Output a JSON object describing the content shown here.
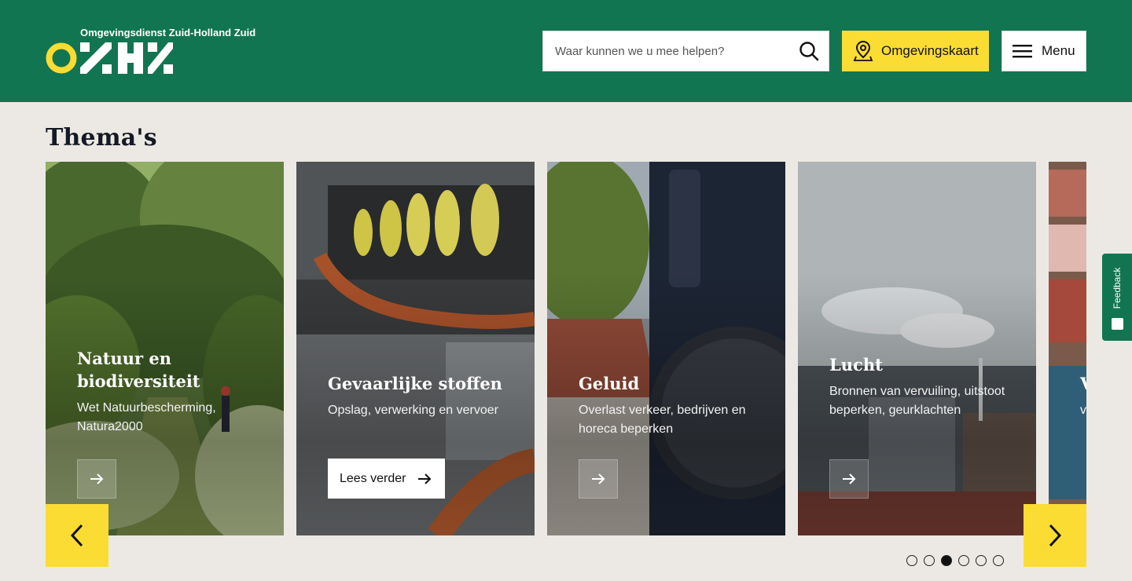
{
  "header": {
    "org_name": "Omgevingsdienst Zuid-Holland Zuid",
    "logo_letters": "OZHZ",
    "search": {
      "placeholder": "Waar kunnen we u mee helpen?"
    },
    "map_button_label": "Omgevingskaart",
    "menu_button_label": "Menu"
  },
  "section": {
    "title": "Thema's",
    "cards": [
      {
        "title": "Natuur en biodiversiteit",
        "description": "Wet Natuurbescherming, Natura2000",
        "image": "forest-path-photo"
      },
      {
        "title": "Gevaarlijke stoffen",
        "description": "Opslag, verwerking en vervoer",
        "image": "hoses-reels-photo",
        "read_more_label": "Lees verder"
      },
      {
        "title": "Geluid",
        "description": "Overlast verkeer, bedrijven en horeca beperken",
        "image": "loudspeaker-photo"
      },
      {
        "title": "Lucht",
        "description": "Bronnen van vervuiling, uitstoot beperken, geurklachten",
        "image": "industry-smoke-photo"
      },
      {
        "title": "V",
        "description": "v",
        "image": "shop-shelves-photo"
      }
    ],
    "pagination": {
      "total": 6,
      "active": 3
    }
  },
  "feedback": {
    "label": "Feedback"
  },
  "colors": {
    "brand_green": "#127552",
    "accent_yellow": "#fbdc33",
    "background": "#ece9e4"
  }
}
